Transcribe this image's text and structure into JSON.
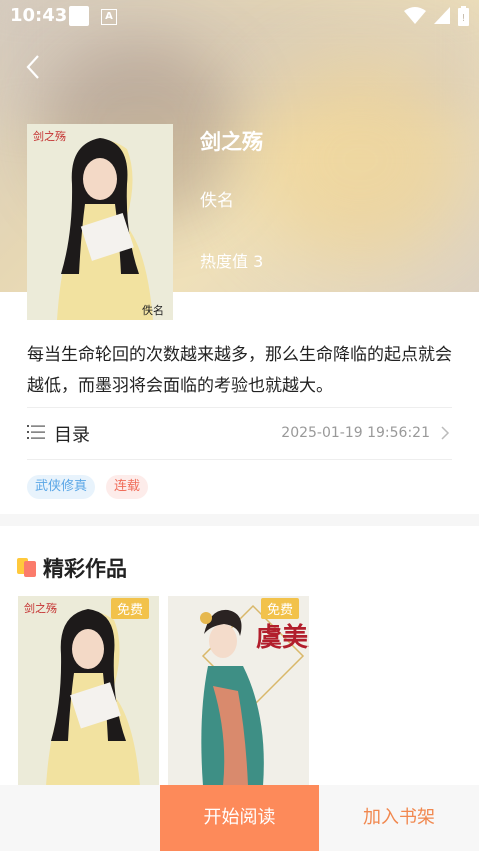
{
  "status_bar": {
    "time": "10:43",
    "notif_letter": "A"
  },
  "book": {
    "title": "剑之殇",
    "author": "佚名",
    "hot_label": "热度值 3",
    "cover_caption": "剑之殇",
    "cover_signature": "佚名",
    "description": "每当生命轮回的次数越来越多，那么生命降临的起点就会越低，而墨羽将会面临的考验也就越大。"
  },
  "toc": {
    "label": "目录",
    "updated": "2025-01-19 19:56:21"
  },
  "tags": [
    "武侠修真",
    "连载"
  ],
  "works": {
    "title": "精彩作品",
    "items": [
      {
        "badge": "免费",
        "cover_text": "剑之殇"
      },
      {
        "badge": "免费",
        "cover_text": "虞美人"
      }
    ]
  },
  "actions": {
    "read": "开始阅读",
    "shelf": "加入书架"
  },
  "colors": {
    "accent": "#fd8a5a",
    "shelf_text": "#f1884f",
    "tag_blue": "#5aa6e6",
    "tag_red": "#f06d5a"
  }
}
